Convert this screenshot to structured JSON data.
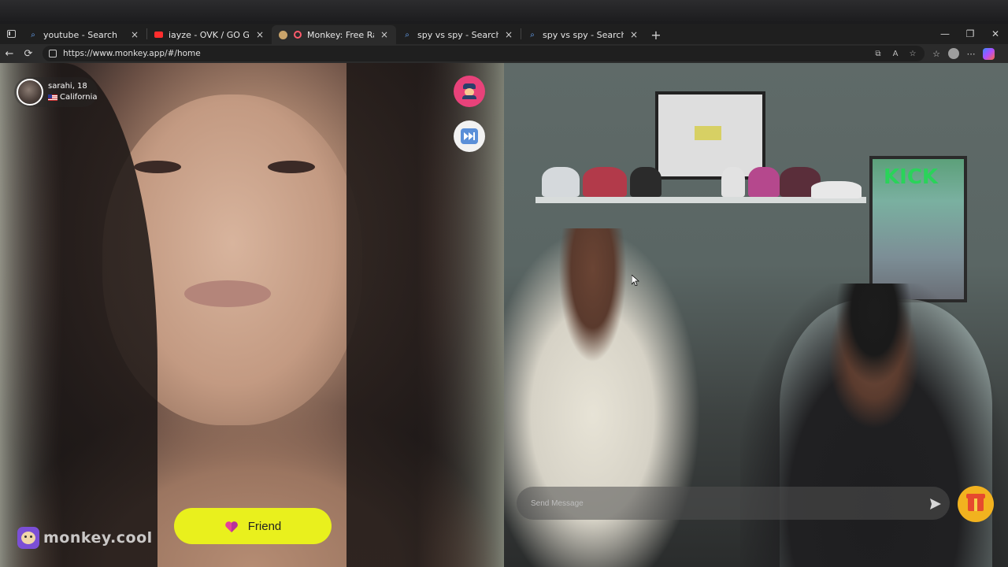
{
  "browser": {
    "tabs": [
      {
        "label": "youtube - Search",
        "favicon": "search-icon",
        "active": false
      },
      {
        "label": "iayze - OVK / GO GO (OFFICIAL M",
        "favicon": "youtube-icon",
        "active": false
      },
      {
        "label": "Monkey: Free Random Vide",
        "favicon": "monkey-icon",
        "active": true
      },
      {
        "label": "spy vs spy - Search",
        "favicon": "search-icon",
        "active": false
      },
      {
        "label": "spy vs spy - Search Images",
        "favicon": "search-icon",
        "active": false
      }
    ],
    "close_glyph": "×",
    "new_tab_glyph": "+",
    "window_controls": {
      "minimize": "—",
      "maximize": "❐",
      "close": "✕"
    },
    "address": {
      "url": "https://www.monkey.app/#/home"
    },
    "nav": {
      "back": "←",
      "refresh": "⟳"
    },
    "url_tools": [
      "⧉",
      "A",
      "☆"
    ],
    "right_tools": [
      "☆",
      "⋯"
    ]
  },
  "stranger": {
    "name_age": "sarahi, 18",
    "location": "California",
    "flag": "us-flag-icon"
  },
  "controls": {
    "report_icon": "police-officer-icon",
    "skip_icon": "fast-forward-icon",
    "friend_label": "Friend",
    "friend_icon": "heart-icon",
    "send_placeholder": "Send Message",
    "send_icon": "send-icon",
    "gift_icon": "gift-icon"
  },
  "brand": {
    "logo_text": "monkey.cool",
    "accent": "#e9f01d",
    "report_color": "#e8427a",
    "gift_color": "#f2b21f"
  },
  "scene": {
    "poster_text": "KICK"
  }
}
